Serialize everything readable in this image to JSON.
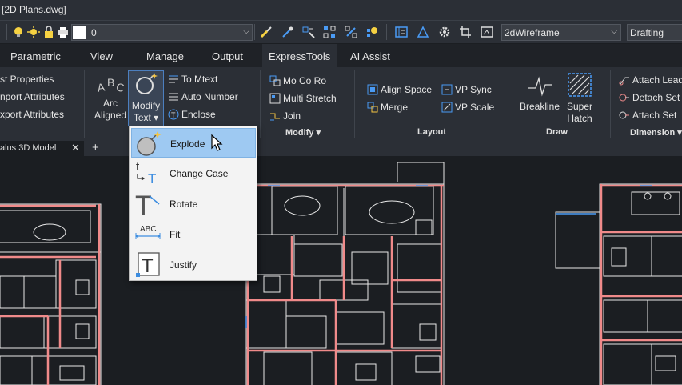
{
  "window": {
    "title": "[2D Plans.dwg]"
  },
  "qat": {
    "layer_value": "0",
    "visual_style": "2dWireframe",
    "workspace": "Drafting"
  },
  "tabs": [
    "Parametric",
    "View",
    "Manage",
    "Output",
    "ExpressTools",
    "AI Assist"
  ],
  "active_tab": "ExpressTools",
  "ribbon": {
    "attributes": [
      "st Properties",
      "nport Attributes",
      "xport Attributes"
    ],
    "text_panel": {
      "arc_aligned": [
        "Arc",
        "Aligned"
      ],
      "modify_text": [
        "Modify",
        "Text ▾"
      ],
      "to_mtext": "To Mtext",
      "auto_number": "Auto Number",
      "enclose": "Enclose"
    },
    "modify_panel": {
      "items": [
        "Mo Co Ro",
        "Multi Stretch",
        "Join"
      ],
      "label": "Modify ▾"
    },
    "layout_panel": {
      "align_space": "Align Space",
      "merge": "Merge",
      "vp_sync": "VP Sync",
      "vp_scale": "VP Scale",
      "label": "Layout"
    },
    "draw_panel": {
      "breakline": "Breakline",
      "super_hatch": [
        "Super",
        "Hatch"
      ],
      "label": "Draw"
    },
    "dimension_panel": {
      "attach_leader": "Attach Lead",
      "detach_set": "Detach Set",
      "attach_set": "Attach Set",
      "label": "Dimension ▾"
    }
  },
  "doc_tab": {
    "name": "alus 3D Model",
    "close": "✕",
    "add": "+"
  },
  "menu": {
    "items": [
      {
        "label": "Explode",
        "icon": "explode-text-icon",
        "highlighted": true
      },
      {
        "label": "Change Case",
        "icon": "change-case-icon"
      },
      {
        "label": "Rotate",
        "icon": "rotate-text-icon"
      },
      {
        "label": "Fit",
        "icon": "fit-text-icon"
      },
      {
        "label": "Justify",
        "icon": "justify-text-icon"
      }
    ]
  },
  "colors": {
    "background": "#1b1e22",
    "ribbon": "#2b2f36",
    "menu_highlight": "#9ec9f2",
    "wall_red": "#f08a8a",
    "accent_blue": "#4a9bf5"
  }
}
